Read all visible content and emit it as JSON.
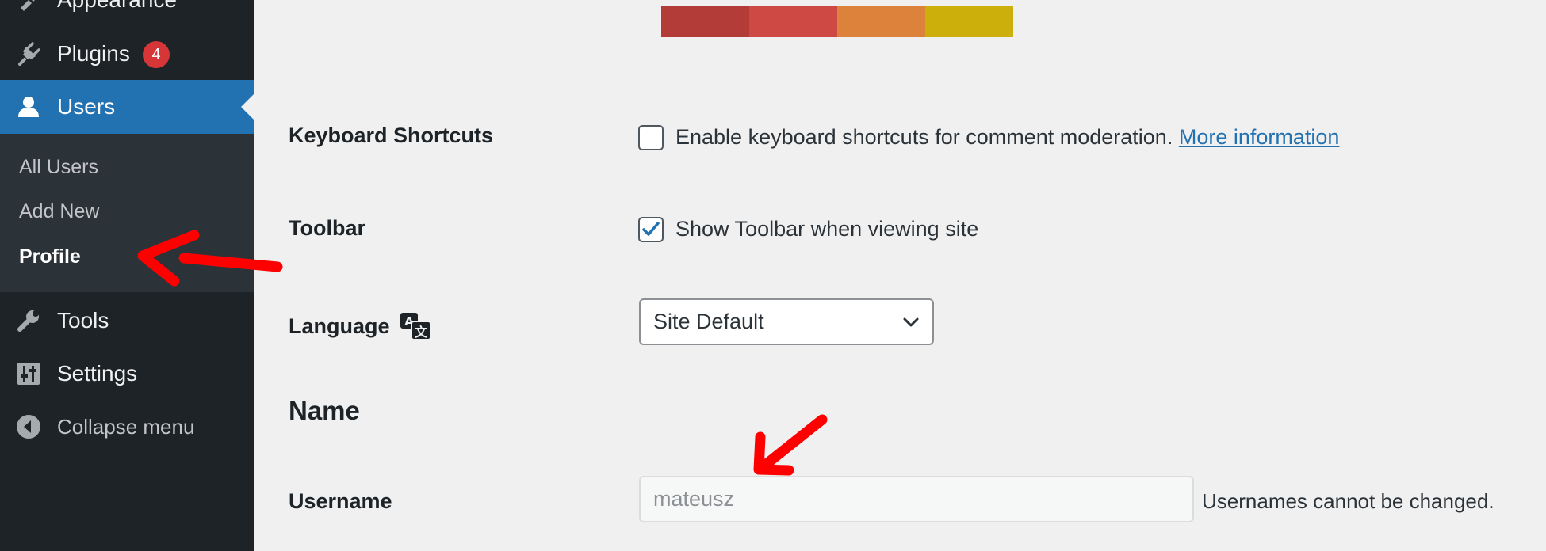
{
  "sidebar": {
    "appearance": {
      "label": "Appearance",
      "icon": "brush-icon"
    },
    "plugins": {
      "label": "Plugins",
      "badge": "4",
      "icon": "plugin-icon"
    },
    "users": {
      "label": "Users",
      "icon": "user-icon"
    },
    "submenu": {
      "all_users": "All Users",
      "add_new": "Add New",
      "profile": "Profile"
    },
    "tools": {
      "label": "Tools",
      "icon": "wrench-icon"
    },
    "settings": {
      "label": "Settings",
      "icon": "settings-sliders-icon"
    },
    "collapse": {
      "label": "Collapse menu",
      "icon": "collapse-arrow-icon"
    }
  },
  "colors": {
    "admin_scheme": [
      "#b43c38",
      "#cf4944",
      "#dd823b",
      "#ccaf0b"
    ],
    "accent": "#2271b1",
    "sidebar_bg": "#1d2327",
    "annotation_arrow": "#ff0000"
  },
  "form": {
    "keyboard_shortcuts": {
      "label": "Keyboard Shortcuts",
      "checked": false,
      "text": "Enable keyboard shortcuts for comment moderation.",
      "link": "More information"
    },
    "toolbar": {
      "label": "Toolbar",
      "checked": true,
      "text": "Show Toolbar when viewing site"
    },
    "language": {
      "label": "Language",
      "icon": "translation-icon",
      "selected": "Site Default"
    },
    "name_section": {
      "title": "Name"
    },
    "username": {
      "label": "Username",
      "value": "mateusz",
      "description": "Usernames cannot be changed."
    }
  }
}
